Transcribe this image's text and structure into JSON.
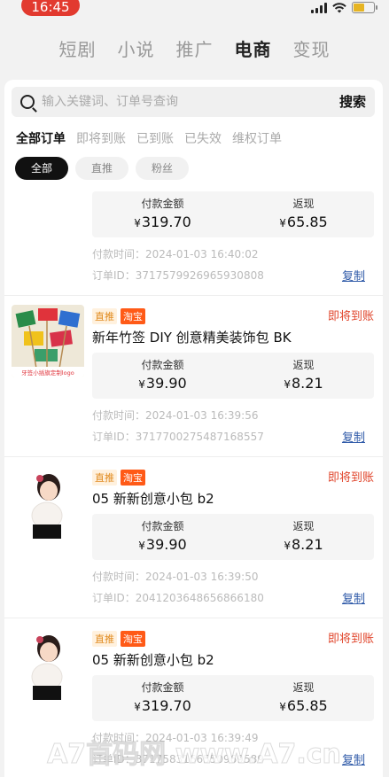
{
  "status_bar": {
    "time": "16:45"
  },
  "top_nav": [
    "短剧",
    "小说",
    "推广",
    "电商",
    "变现"
  ],
  "top_nav_active": 3,
  "search": {
    "placeholder": "输入关键词、订单号查询",
    "button": "搜索"
  },
  "status_tabs": [
    "全部订单",
    "即将到账",
    "已到账",
    "已失效",
    "维权订单"
  ],
  "status_tabs_active": 0,
  "filter_chips": [
    "全部",
    "直推",
    "粉丝"
  ],
  "filter_chips_active": 0,
  "labels": {
    "pay_amount": "付款金额",
    "rebate": "返现",
    "pay_time_prefix": "付款时间：",
    "order_id_prefix": "订单ID：",
    "copy": "复制",
    "currency": "¥"
  },
  "orders": [
    {
      "pay_amount": "319.70",
      "rebate": "65.85",
      "pay_time": "2024-01-03 16:40:02",
      "order_id": "3717579926965930808"
    },
    {
      "tag_1": "直推",
      "tag_2": "淘宝",
      "status": "即将到账",
      "title": "新年竹签 DIY 创意精美装饰包 BK",
      "pay_amount": "39.90",
      "rebate": "8.21",
      "pay_time": "2024-01-03 16:39:56",
      "order_id": "3717700275487168557",
      "thumb_caption": "牙签小插旗定制logo"
    },
    {
      "tag_1": "直推",
      "tag_2": "淘宝",
      "status": "即将到账",
      "title": "05 新新创意小包 b2",
      "pay_amount": "39.90",
      "rebate": "8.21",
      "pay_time": "2024-01-03 16:39:50",
      "order_id": "2041203648656866180"
    },
    {
      "tag_1": "直推",
      "tag_2": "淘宝",
      "status": "即将到账",
      "title": "05 新新创意小包 b2",
      "pay_amount": "319.70",
      "rebate": "65.85",
      "pay_time": "2024-01-03 16:39:49",
      "order_id": "3717583166550969589"
    }
  ],
  "watermark": "A7首码网 www.A7.cn"
}
